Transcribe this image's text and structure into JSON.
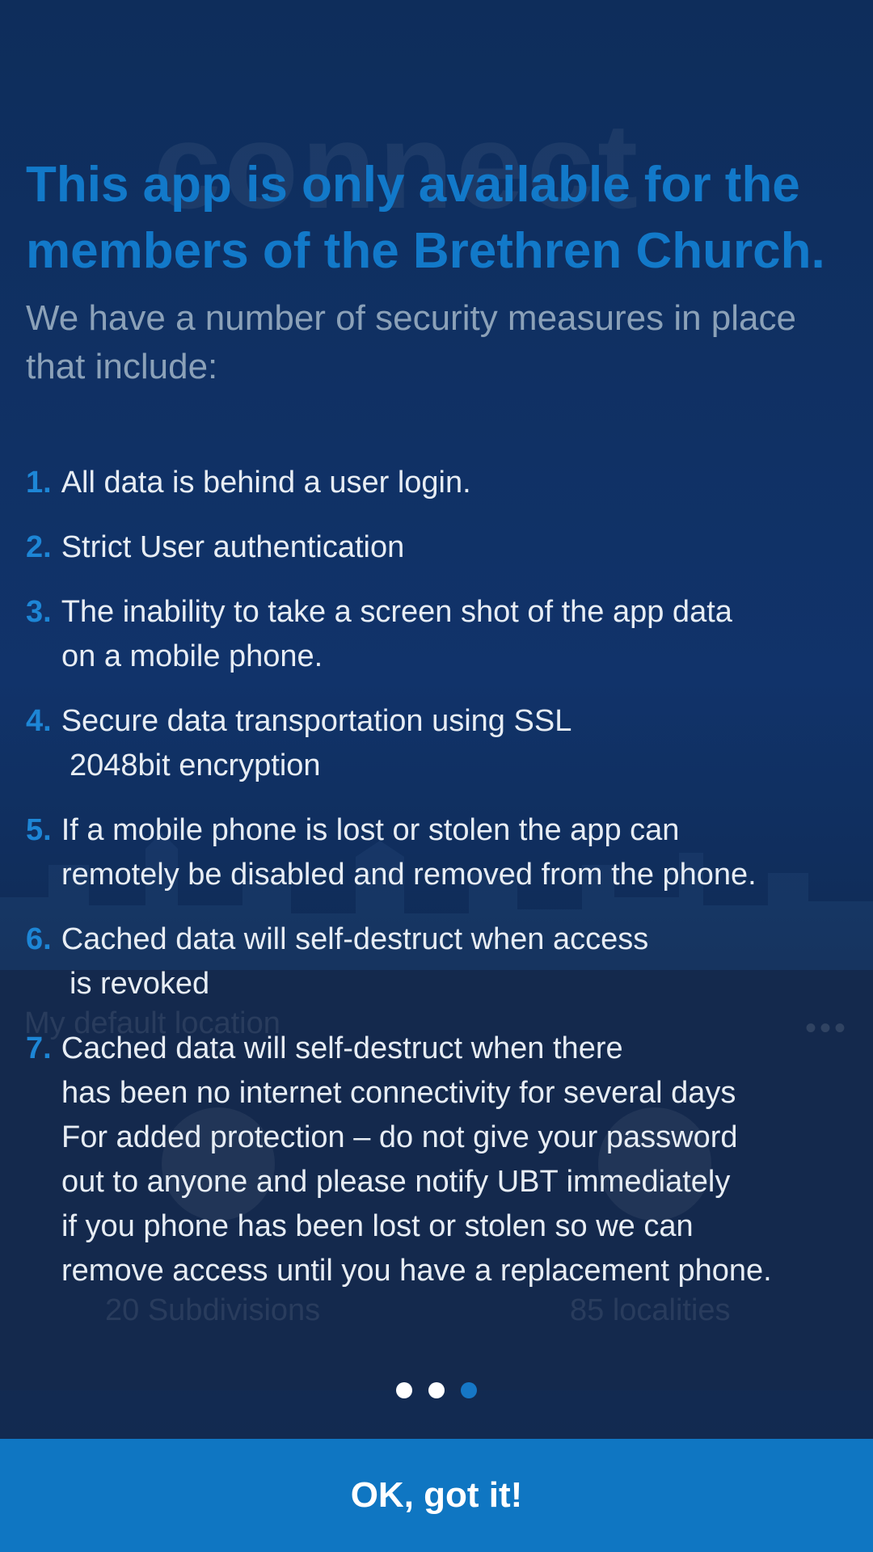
{
  "background": {
    "logo_text": "connect",
    "location_title": "My default location",
    "more_icon": "more-horizontal-icon",
    "stats": [
      {
        "label": "20 Subdivisions"
      },
      {
        "label": "85 localities"
      }
    ]
  },
  "onboarding": {
    "headline": "This app is only available for the members of the Brethren Church.",
    "subtitle": "We have a number of security measures in place that include:",
    "measures": [
      {
        "num": "1.",
        "line1": "All data is behind a user login."
      },
      {
        "num": "2.",
        "line1": "Strict User authentication"
      },
      {
        "num": "3.",
        "line1": "The inability to take a screen shot of the app data",
        "line2": "on a mobile phone."
      },
      {
        "num": "4.",
        "line1": "Secure data transportation using SSL",
        "line2": "2048bit encryption"
      },
      {
        "num": "5.",
        "line1": "If a mobile phone is lost or stolen the app can",
        "line2": "remotely be disabled and removed from the phone."
      },
      {
        "num": "6.",
        "line1": "Cached data will self-destruct when access",
        "line2": "is revoked"
      },
      {
        "num": "7.",
        "line1": "Cached data will self-destruct when there",
        "lines": [
          "has been no internet connectivity for several days",
          "For added protection – do not give your password",
          "out to anyone and please notify UBT immediately",
          "if you phone has been lost or stolen so we can",
          "remove access until you have a replacement phone."
        ]
      }
    ],
    "page_count": 3,
    "active_page": 3
  },
  "button": {
    "label": "OK, got it!"
  },
  "colors": {
    "accent": "#1279c9",
    "button": "#0f76c2",
    "background": "#0f2f5b"
  }
}
